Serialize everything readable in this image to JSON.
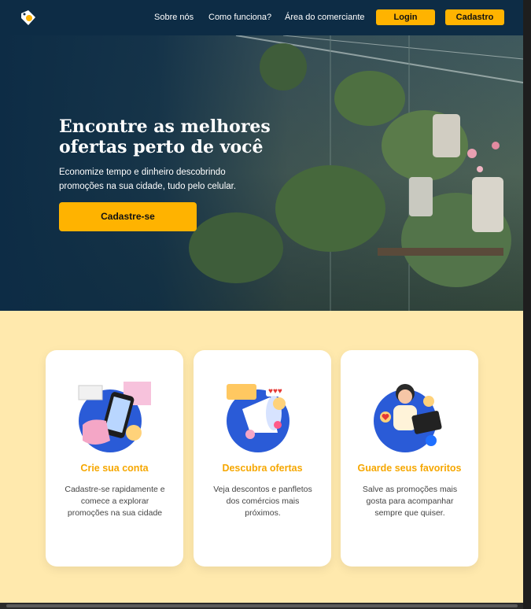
{
  "header": {
    "nav": [
      "Sobre nós",
      "Como funciona?",
      "Área do comerciante"
    ],
    "login_label": "Login",
    "signup_label": "Cadastro"
  },
  "hero": {
    "title_line1": "Encontre as melhores",
    "title_line2": "ofertas perto de você",
    "subtitle": "Economize tempo e dinheiro descobrindo promoções na sua cidade, tudo pelo celular.",
    "cta": "Cadastre-se"
  },
  "features": [
    {
      "title": "Crie sua conta",
      "text": "Cadastre-se rapidamente e comece a explorar promoções na sua cidade",
      "icon": "phone-shopping-icon"
    },
    {
      "title": "Descubra ofertas",
      "text": "Veja descontos e panfletos dos comércios mais próximos.",
      "icon": "megaphone-icon"
    },
    {
      "title": "Guarde seus favoritos",
      "text": "Salve as promoções mais gosta para acompanhar sempre que quiser.",
      "icon": "person-laptop-icon"
    }
  ],
  "colors": {
    "primary": "#ffb300",
    "dark": "#0d2c45",
    "bg": "#ffe9ad"
  }
}
